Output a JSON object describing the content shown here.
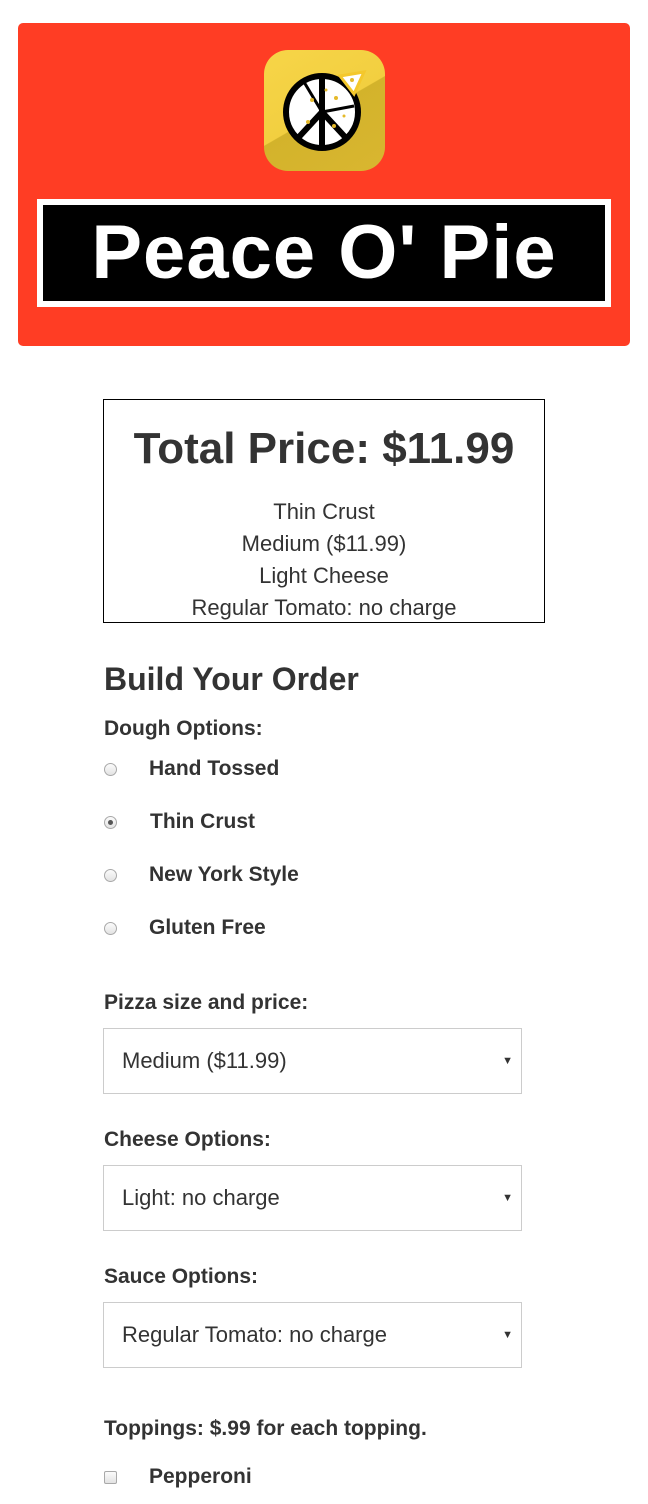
{
  "brand": {
    "name": "Peace O' Pie",
    "logo_icon": "peace-pizza-icon",
    "colors": {
      "header_bg": "#ff3d24",
      "logo_bg": "#f2cf40",
      "title_bg": "#000000"
    }
  },
  "summary": {
    "total_label": "Total Price: $11.99",
    "lines": [
      "Thin Crust",
      "Medium ($11.99)",
      "Light Cheese",
      "Regular Tomato: no charge"
    ]
  },
  "order": {
    "heading": "Build Your Order",
    "dough": {
      "label": "Dough Options:",
      "options": [
        {
          "label": "Hand Tossed",
          "checked": false
        },
        {
          "label": "Thin Crust",
          "checked": true
        },
        {
          "label": "New York Style",
          "checked": false
        },
        {
          "label": "Gluten Free",
          "checked": false
        }
      ]
    },
    "size": {
      "label": "Pizza size and price:",
      "selected": "Medium ($11.99)"
    },
    "cheese": {
      "label": "Cheese Options:",
      "selected": "Light: no charge"
    },
    "sauce": {
      "label": "Sauce Options:",
      "selected": "Regular Tomato: no charge"
    },
    "toppings": {
      "label": "Toppings: $.99 for each topping.",
      "items": [
        {
          "label": "Pepperoni",
          "checked": false
        }
      ]
    },
    "dropdown_icon": "caret-down-icon",
    "caret_glyph": "▼"
  }
}
